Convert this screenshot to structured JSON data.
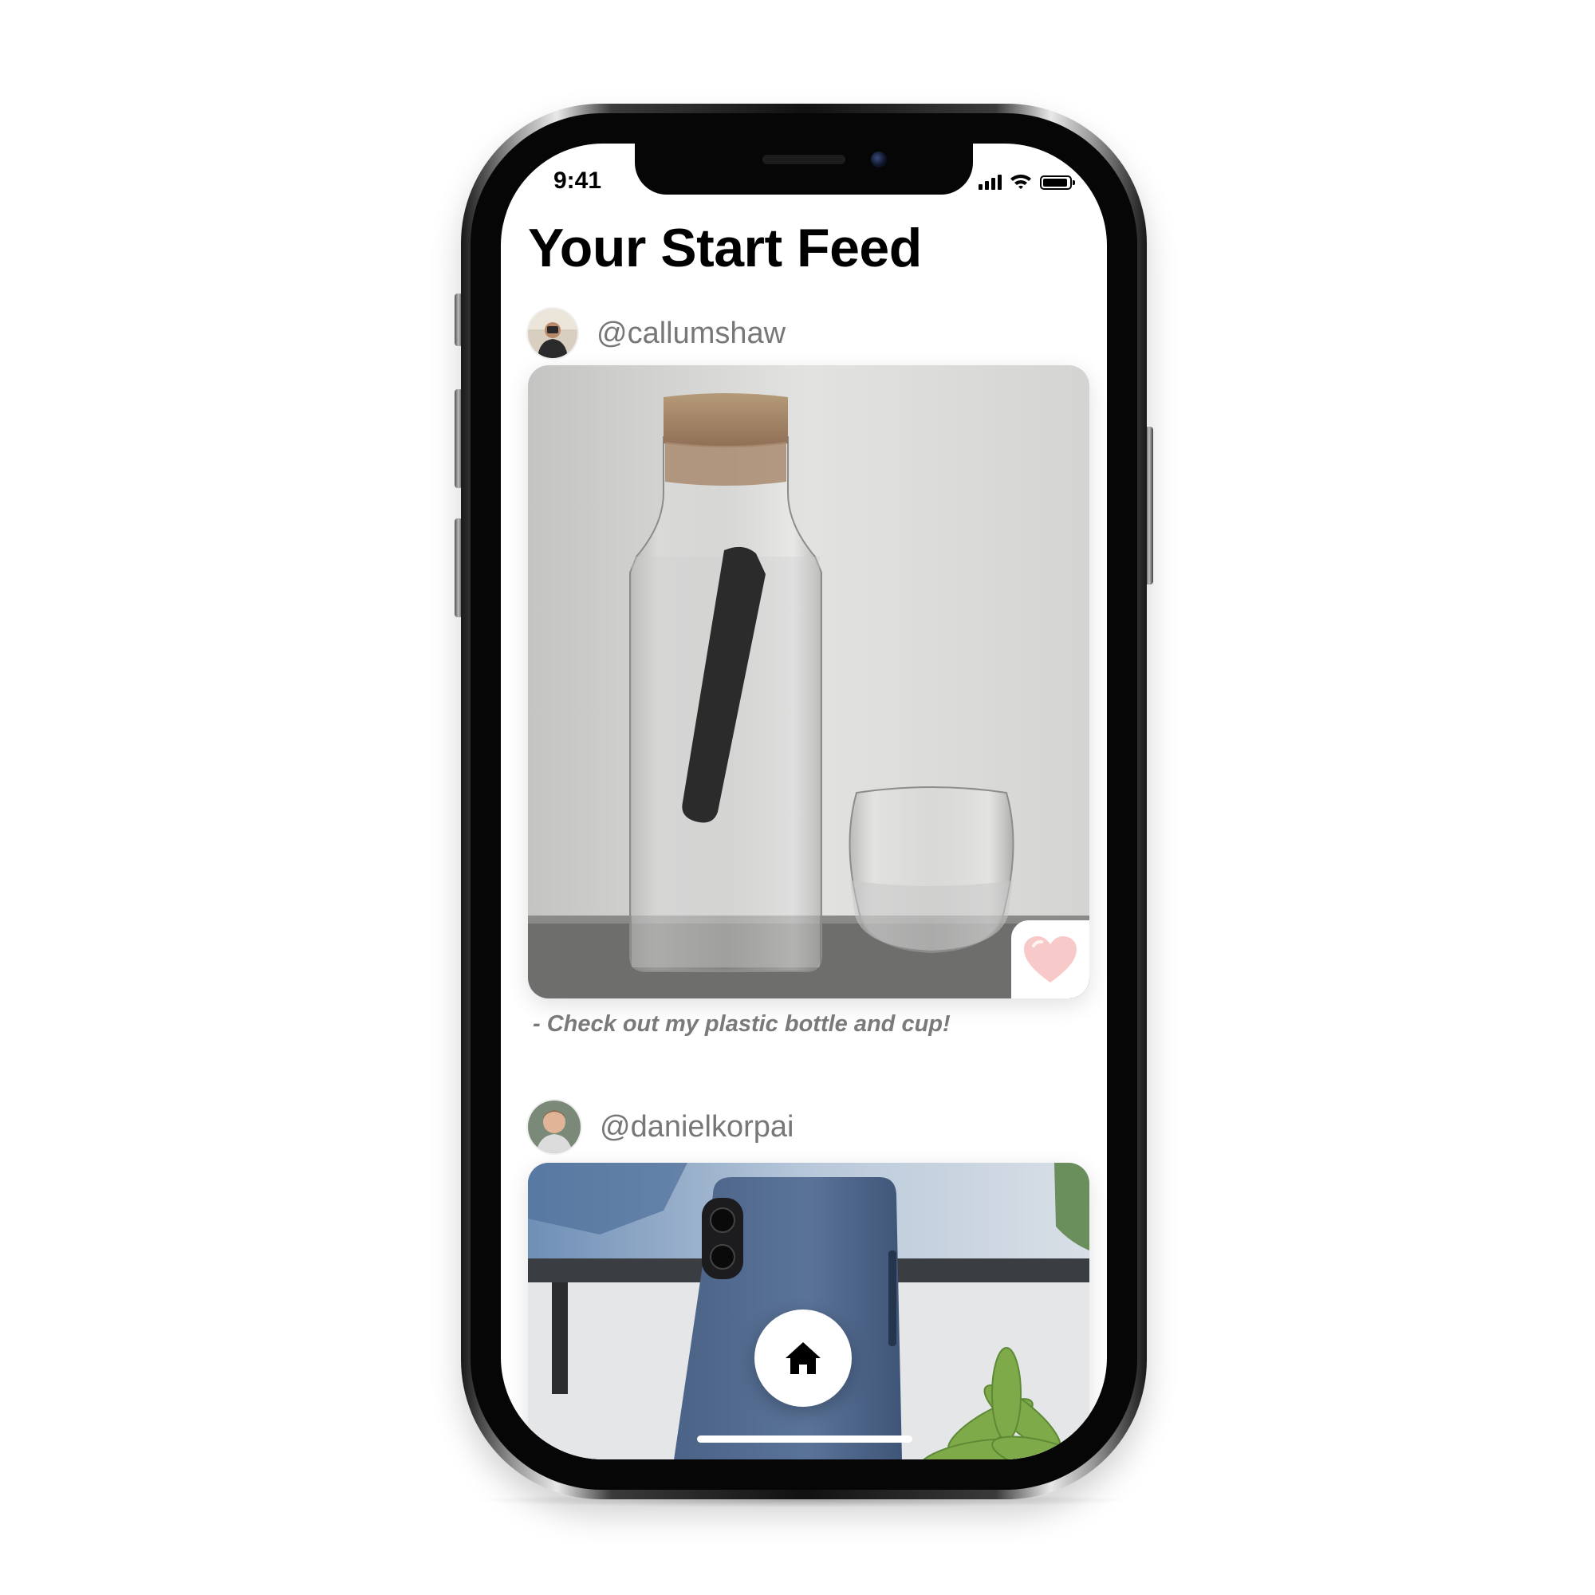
{
  "status_bar": {
    "time": "9:41"
  },
  "header": {
    "title": "Your Start Feed"
  },
  "posts": [
    {
      "username": "@callumshaw",
      "caption": "- Check out my plastic bottle and cup!",
      "liked": false
    },
    {
      "username": "@danielkorpai"
    }
  ],
  "icons": {
    "like": "heart-icon",
    "home": "home-icon",
    "wifi": "wifi-icon",
    "signal": "cellular-signal-icon",
    "battery": "battery-icon"
  },
  "colors": {
    "heart": "#f7c9c9",
    "username": "#777777",
    "caption": "#7a7a7a"
  }
}
